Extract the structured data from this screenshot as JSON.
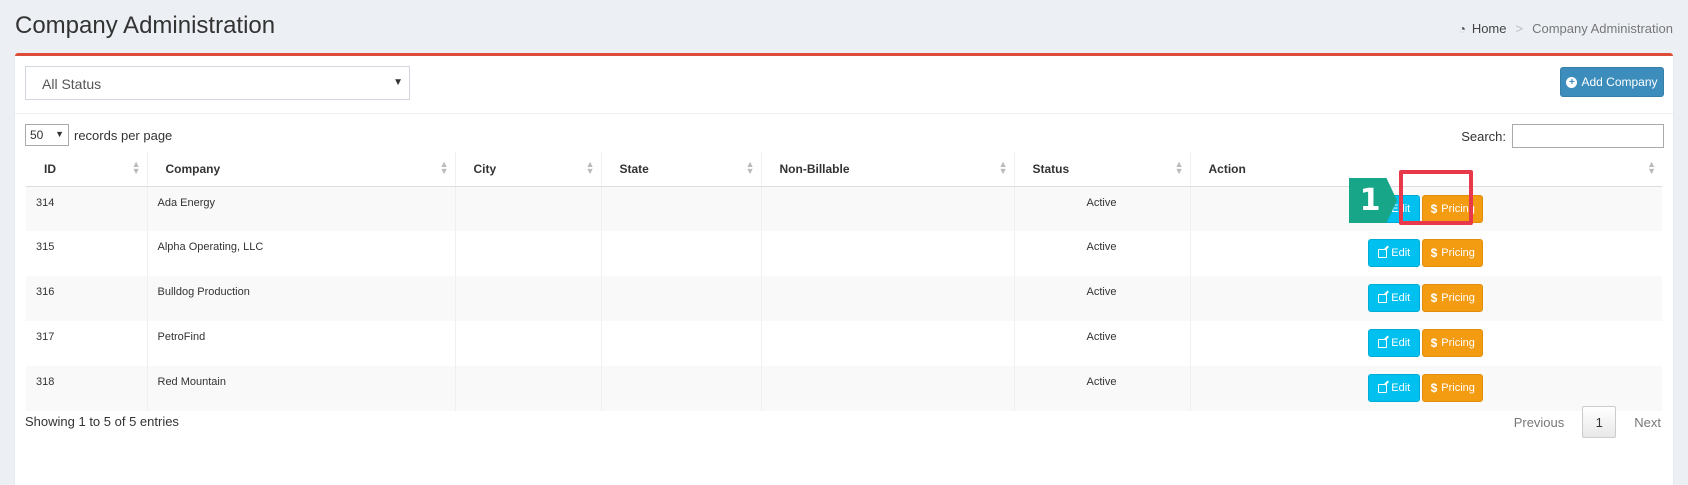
{
  "header": {
    "title": "Company Administration",
    "breadcrumb": {
      "icon": "dashboard-icon",
      "home": "Home",
      "separator": ">",
      "current": "Company Administration"
    }
  },
  "filter": {
    "status_selected": "All Status"
  },
  "toolbar": {
    "add_label": "Add Company"
  },
  "table_controls": {
    "length_value": "50",
    "length_suffix": "records per page",
    "search_label": "Search:",
    "search_value": ""
  },
  "table": {
    "columns": [
      "ID",
      "Company",
      "City",
      "State",
      "Non-Billable",
      "Status",
      "Action"
    ],
    "rows": [
      {
        "id": "314",
        "company": "Ada Energy",
        "city": "",
        "state": "",
        "non_billable": "",
        "status": "Active"
      },
      {
        "id": "315",
        "company": "Alpha Operating, LLC",
        "city": "",
        "state": "",
        "non_billable": "",
        "status": "Active"
      },
      {
        "id": "316",
        "company": "Bulldog Production",
        "city": "",
        "state": "",
        "non_billable": "",
        "status": "Active"
      },
      {
        "id": "317",
        "company": "PetroFind",
        "city": "",
        "state": "",
        "non_billable": "",
        "status": "Active"
      },
      {
        "id": "318",
        "company": "Red Mountain",
        "city": "",
        "state": "",
        "non_billable": "",
        "status": "Active"
      }
    ],
    "edit_label": "Edit",
    "pricing_label": "Pricing"
  },
  "annotation": {
    "step_number": "1"
  },
  "footer": {
    "info": "Showing 1 to 5 of 5 entries",
    "previous": "Previous",
    "page": "1",
    "next": "Next"
  },
  "colors": {
    "box_top_border": "#dd4b39",
    "primary": "#3c8dbc",
    "info": "#00c0ef",
    "warning": "#f39c12",
    "highlight": "#e8394a",
    "step_marker": "#18a689"
  }
}
